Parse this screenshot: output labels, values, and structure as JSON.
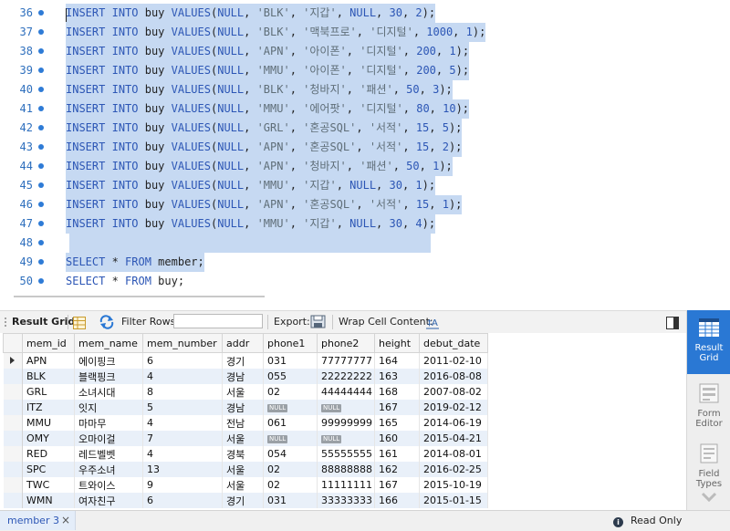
{
  "editor": {
    "lines": [
      {
        "num": "36",
        "code": "INSERT INTO buy VALUES(NULL, 'BLK', '지갑', NULL, 30, 2);",
        "selected": true
      },
      {
        "num": "37",
        "code": "INSERT INTO buy VALUES(NULL, 'BLK', '맥북프로', '디지털', 1000, 1);",
        "selected": true
      },
      {
        "num": "38",
        "code": "INSERT INTO buy VALUES(NULL, 'APN', '아이폰', '디지털', 200, 1);",
        "selected": true
      },
      {
        "num": "39",
        "code": "INSERT INTO buy VALUES(NULL, 'MMU', '아이폰', '디지털', 200, 5);",
        "selected": true
      },
      {
        "num": "40",
        "code": "INSERT INTO buy VALUES(NULL, 'BLK', '청바지', '패션', 50, 3);",
        "selected": true
      },
      {
        "num": "41",
        "code": "INSERT INTO buy VALUES(NULL, 'MMU', '에어팟', '디지털', 80, 10);",
        "selected": true
      },
      {
        "num": "42",
        "code": "INSERT INTO buy VALUES(NULL, 'GRL', '혼공SQL', '서적', 15, 5);",
        "selected": true
      },
      {
        "num": "43",
        "code": "INSERT INTO buy VALUES(NULL, 'APN', '혼공SQL', '서적', 15, 2);",
        "selected": true
      },
      {
        "num": "44",
        "code": "INSERT INTO buy VALUES(NULL, 'APN', '청바지', '패션', 50, 1);",
        "selected": true
      },
      {
        "num": "45",
        "code": "INSERT INTO buy VALUES(NULL, 'MMU', '지갑', NULL, 30, 1);",
        "selected": true
      },
      {
        "num": "46",
        "code": "INSERT INTO buy VALUES(NULL, 'APN', '혼공SQL', '서적', 15, 1);",
        "selected": true
      },
      {
        "num": "47",
        "code": "INSERT INTO buy VALUES(NULL, 'MMU', '지갑', NULL, 30, 4);",
        "selected": true
      },
      {
        "num": "48",
        "code": "",
        "selected": true
      },
      {
        "num": "49",
        "code": "SELECT * FROM member;",
        "selected": true
      },
      {
        "num": "50",
        "code": "SELECT * FROM buy;",
        "selected": false
      }
    ]
  },
  "toolbar": {
    "result_grid_label": "Result Grid",
    "filter_rows_label": "Filter Rows:",
    "filter_value": "",
    "export_label": "Export:",
    "wrap_label": "Wrap Cell Content:"
  },
  "grid": {
    "columns": [
      "mem_id",
      "mem_name",
      "mem_number",
      "addr",
      "phone1",
      "phone2",
      "height",
      "debut_date"
    ],
    "rows": [
      [
        "APN",
        "에이핑크",
        "6",
        "경기",
        "031",
        "77777777",
        "164",
        "2011-02-10"
      ],
      [
        "BLK",
        "블랙핑크",
        "4",
        "경남",
        "055",
        "22222222",
        "163",
        "2016-08-08"
      ],
      [
        "GRL",
        "소녀시대",
        "8",
        "서울",
        "02",
        "44444444",
        "168",
        "2007-08-02"
      ],
      [
        "ITZ",
        "잇지",
        "5",
        "경남",
        "NULL",
        "NULL",
        "167",
        "2019-02-12"
      ],
      [
        "MMU",
        "마마무",
        "4",
        "전남",
        "061",
        "99999999",
        "165",
        "2014-06-19"
      ],
      [
        "OMY",
        "오마이걸",
        "7",
        "서울",
        "NULL",
        "NULL",
        "160",
        "2015-04-21"
      ],
      [
        "RED",
        "레드벨벳",
        "4",
        "경북",
        "054",
        "55555555",
        "161",
        "2014-08-01"
      ],
      [
        "SPC",
        "우주소녀",
        "13",
        "서울",
        "02",
        "88888888",
        "162",
        "2016-02-25"
      ],
      [
        "TWC",
        "트와이스",
        "9",
        "서울",
        "02",
        "11111111",
        "167",
        "2015-10-19"
      ],
      [
        "WMN",
        "여자친구",
        "6",
        "경기",
        "031",
        "33333333",
        "166",
        "2015-01-15"
      ]
    ]
  },
  "sidepanel": {
    "result_grid": "Result Grid",
    "form_editor": "Form Editor",
    "field_types": "Field Types"
  },
  "status": {
    "tab_label": "member 3",
    "close_glyph": "×",
    "info_glyph": "i",
    "readonly_label": "Read Only"
  },
  "colors": {
    "accent": "#2a78d4",
    "selection": "#c6d9f2",
    "keyword": "#2c56b5"
  }
}
